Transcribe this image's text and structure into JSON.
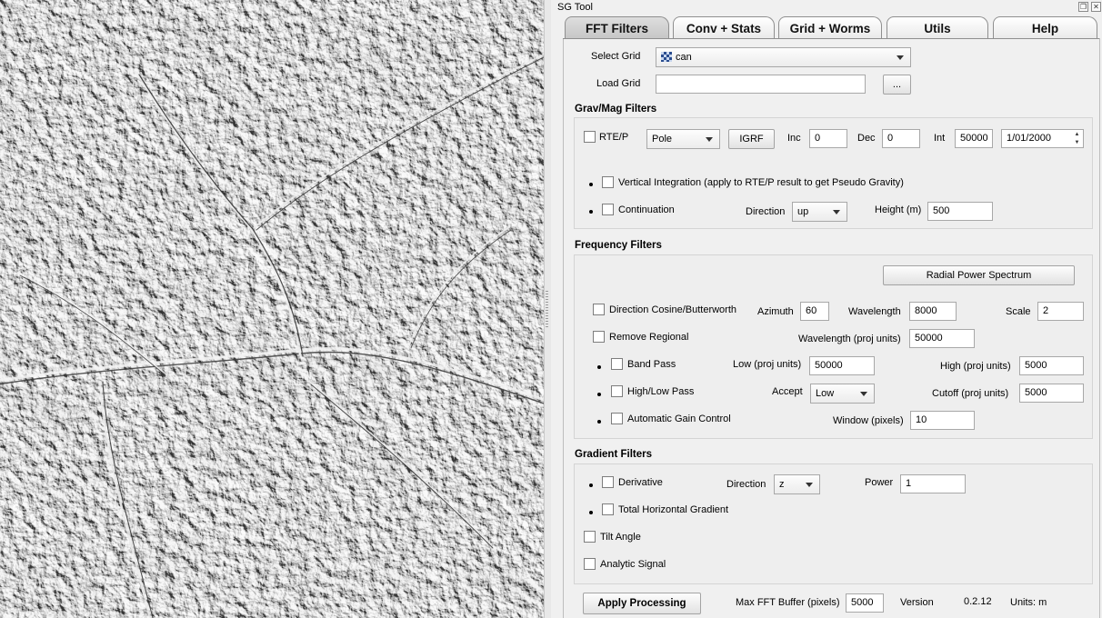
{
  "window": {
    "title": "SG Tool"
  },
  "tabs": [
    {
      "label": "FFT Filters"
    },
    {
      "label": "Conv + Stats"
    },
    {
      "label": "Grid + Worms"
    },
    {
      "label": "Utils"
    },
    {
      "label": "Help"
    }
  ],
  "grid": {
    "select_label": "Select Grid",
    "select_value": "can",
    "load_label": "Load Grid",
    "load_value": "",
    "browse_label": "..."
  },
  "gravmag": {
    "title": "Grav/Mag Filters",
    "rtep_label": "RTE/P",
    "pole_value": "Pole",
    "igrf_label": "IGRF",
    "inc_label": "Inc",
    "inc_value": "0",
    "dec_label": "Dec",
    "dec_value": "0",
    "int_label": "Int",
    "int_value": "50000",
    "date_value": "1/01/2000",
    "vertical_integration_label": "Vertical Integration (apply to RTE/P result to get Pseudo Gravity)",
    "continuation_label": "Continuation",
    "direction_label": "Direction",
    "direction_value": "up",
    "height_label": "Height (m)",
    "height_value": "500"
  },
  "frequency": {
    "title": "Frequency Filters",
    "rps_label": "Radial Power Spectrum",
    "dircos_label": "Direction Cosine/Butterworth",
    "azimuth_label": "Azimuth",
    "azimuth_value": "60",
    "wavelength_label": "Wavelength",
    "wavelength_value": "8000",
    "scale_label": "Scale",
    "scale_value": "2",
    "remove_regional_label": "Remove Regional",
    "regional_wavelength_label": "Wavelength (proj units)",
    "regional_wavelength_value": "50000",
    "bandpass_label": "Band Pass",
    "low_label": "Low (proj units)",
    "low_value": "50000",
    "high_label": "High (proj units)",
    "high_value": "5000",
    "highlow_label": "High/Low Pass",
    "accept_label": "Accept",
    "accept_value": "Low",
    "cutoff_label": "Cutoff (proj units)",
    "cutoff_value": "5000",
    "agc_label": "Automatic Gain Control",
    "window_label": "Window (pixels)",
    "window_value": "10"
  },
  "gradient": {
    "title": "Gradient Filters",
    "derivative_label": "Derivative",
    "direction_label": "Direction",
    "direction_value": "z",
    "power_label": "Power",
    "power_value": "1",
    "thg_label": "Total Horizontal Gradient",
    "tilt_label": "Tilt Angle",
    "analytic_label": "Analytic Signal"
  },
  "footer": {
    "apply_label": "Apply Processing",
    "buffer_label": "Max FFT Buffer (pixels)",
    "buffer_value": "5000",
    "version_label": "Version",
    "version_value": "0.2.12",
    "units_label": "Units: m"
  }
}
